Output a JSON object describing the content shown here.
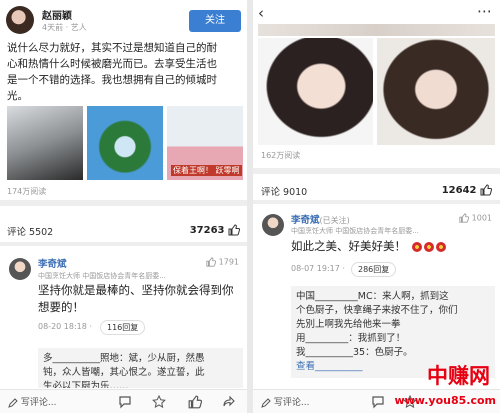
{
  "left": {
    "author": {
      "name": "赵丽颖",
      "meta": "4天前 · 艺人"
    },
    "follow_label": "关注",
    "post_lines": [
      "说什么尽力就好，其实不过是想知道自己的耐",
      "心和热情什么时候被磨光而已。去享受生活也",
      "是一个不错的选择。我也想拥有自己的倾城时",
      "光。"
    ],
    "img3_caption": "保着王啊！ 跃零啊",
    "reads": "174万阅读",
    "comment_count": "评论 5502",
    "like_count": "37263",
    "comment": {
      "name": "李奇斌",
      "sub": "中国烹饪大师 中国饭店协会青年名厨委...",
      "likes": "1791",
      "text_lines": [
        "坚持你就是最棒的、坚持你就会得到你",
        "想要的！"
      ],
      "time": "08-20 18:18 ·",
      "replies": "116回复",
      "reply_lines": [
        "多__________照地：斌，少从厨，然愚",
        "钝，众人皆嘲，其心恨之。遂立誓，此",
        "生必以下厨为乐……"
      ]
    },
    "write_comment": "写评论..."
  },
  "right": {
    "reads": "162万阅读",
    "comment_count": "评论 9010",
    "like_count": "12642",
    "comment": {
      "name": "李奇斌",
      "tag": "(已关注)",
      "sub": "中国烹饪大师 中国饭店协会青年名厨委...",
      "likes": "1001",
      "text": "如此之美、好美好美！",
      "time": "08-07 19:17 ·",
      "replies": "286回复",
      "reply_lines": [
        "中国_________MC：来人啊，抓到这",
        "个色厨子，快拿绳子来按不住了，你们",
        "先別上啊我先给他来一拳",
        "用_________：我抓到了！",
        "我__________35：色厨子。",
        "查看__________"
      ]
    },
    "write_comment": "写评论..."
  },
  "watermark": {
    "brand": "中赚网",
    "url": "www.you85.com"
  }
}
